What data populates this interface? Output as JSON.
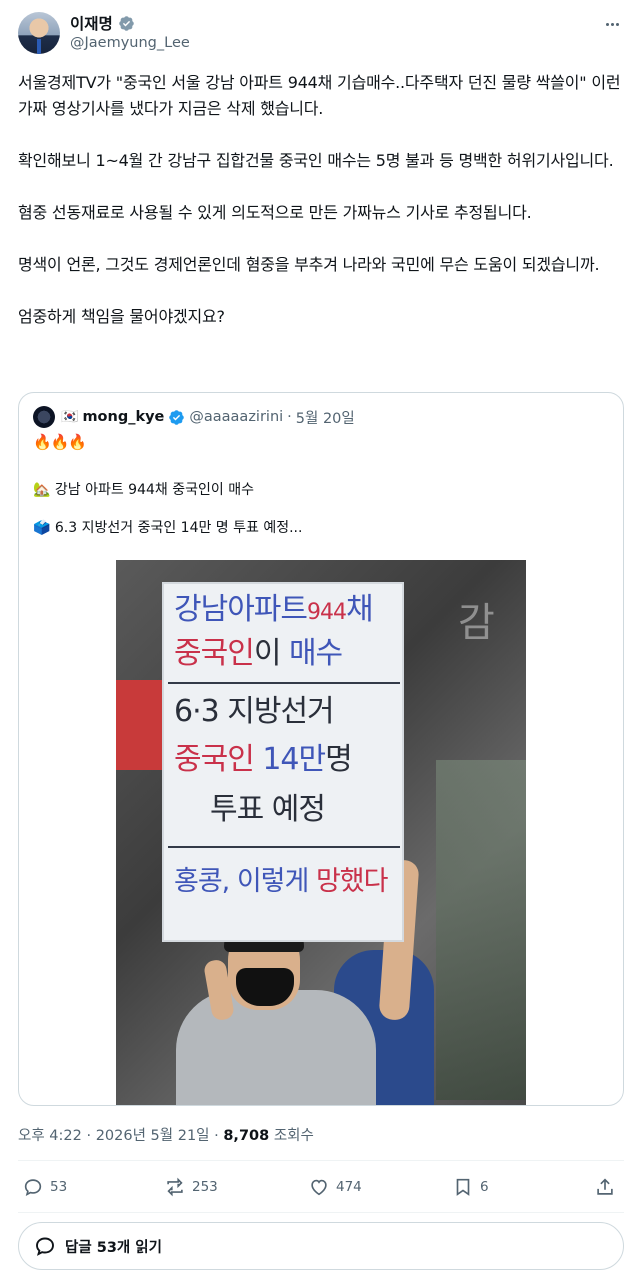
{
  "author": {
    "display_name": "이재명",
    "handle": "@Jaemyung_Lee",
    "verified_icon": "verified-badge-icon",
    "more_icon": "more-options-icon"
  },
  "body": {
    "paragraphs": [
      "서울경제TV가 \"중국인 서울 강남 아파트 944채 기습매수..다주택자 던진 물량 싹쓸이\" 이런 가짜 영상기사를 냈다가 지금은 삭제 했습니다.",
      "확인해보니 1~4월 간 강남구 집합건물 중국인 매수는 5명 불과 등 명백한 허위기사입니다.",
      "혐중 선동재료로 사용될 수 있게 의도적으로 만든 가짜뉴스 기사로 추정됩니다.",
      "명색이 언론, 그것도 경제언론인데 혐중을 부추겨 나라와 국민에 무슨 도움이 되겠습니까.",
      "엄중하게 책임을 물어야겠지요?"
    ]
  },
  "quote": {
    "flag": "🇰🇷",
    "name": "mong_kye",
    "handle": "@aaaaazirini",
    "separator": "·",
    "date": "5월 20일",
    "fire": "🔥🔥🔥",
    "line1": "🏡 강남 아파트 944채 중국인이 매수",
    "line2": "🗳️ 6.3 지방선거 중국인 14만 명 투표 예정...",
    "placard": {
      "l1a": "강남아파트",
      "l1b": "944",
      "l1c": "채",
      "l2a": "중국인",
      "l2b": "이 ",
      "l2c": "매수",
      "l3": "6·3 지방선거",
      "l4a": "중국인 ",
      "l4b": "14만",
      "l4c": "명",
      "l5": "투표 예정",
      "l6a": "홍콩, 이렇게 ",
      "l6b": "망했다"
    },
    "placard_colors": {
      "blue": "#3f56b8",
      "red": "#c9314a",
      "dark": "#2a2f3a"
    }
  },
  "meta": {
    "time": "오후 4:22",
    "sep1": " · ",
    "date": "2026년 5월 21일",
    "sep2": " · ",
    "views": "8,708",
    "views_label": " 조회수"
  },
  "actions": {
    "reply_count": "53",
    "retweet_count": "253",
    "like_count": "474",
    "bookmark_count": "6"
  },
  "reply_button": {
    "label": "답글 53개 읽기"
  },
  "colors": {
    "text": "#0f1419",
    "muted": "#536471",
    "border": "#cfd9de",
    "verified": "#829aab"
  }
}
